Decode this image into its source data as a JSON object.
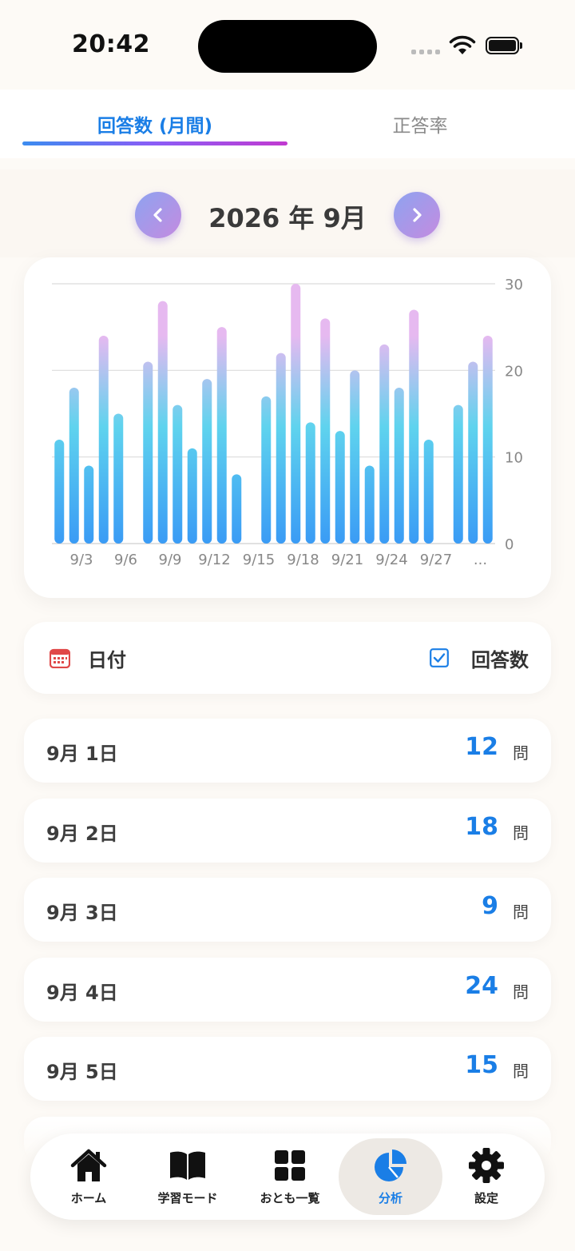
{
  "status_bar": {
    "time": "20:42"
  },
  "tabs": [
    {
      "label": "回答数 (月間)",
      "active": true
    },
    {
      "label": "正答率",
      "active": false
    }
  ],
  "month_nav": {
    "title": "2026 年 9月",
    "prev_icon": "chevron-left-icon",
    "next_icon": "chevron-right-icon"
  },
  "chart_data": {
    "type": "bar",
    "categories": [
      "9/1",
      "9/2",
      "9/3",
      "9/4",
      "9/5",
      "9/6",
      "9/7",
      "9/8",
      "9/9",
      "9/10",
      "9/11",
      "9/12",
      "9/13",
      "9/14",
      "9/15",
      "9/16",
      "9/17",
      "9/18",
      "9/19",
      "9/20",
      "9/21",
      "9/22",
      "9/23",
      "9/24",
      "9/25",
      "9/26",
      "9/27",
      "9/28",
      "9/29",
      "9/30"
    ],
    "values": [
      12,
      18,
      9,
      24,
      15,
      0,
      21,
      28,
      16,
      11,
      19,
      25,
      8,
      0,
      17,
      22,
      30,
      14,
      26,
      13,
      20,
      9,
      23,
      18,
      27,
      12,
      0,
      16,
      21,
      24
    ],
    "x_tick_labels": [
      "9/3",
      "9/6",
      "9/9",
      "9/12",
      "9/15",
      "9/18",
      "9/21",
      "9/24",
      "9/27",
      "..."
    ],
    "y_ticks": [
      0,
      10,
      20,
      30
    ],
    "ylim": [
      0,
      30
    ],
    "grid": true,
    "colors": {
      "bottom": "#3a9bf5",
      "middle": "#5fd3ee",
      "top": "#e6b9f0"
    }
  },
  "list_header": {
    "date_label": "日付",
    "count_label": "回答数",
    "date_icon": "calendar-icon",
    "count_icon": "checkbox-icon"
  },
  "rows": [
    {
      "date": "9月 1日",
      "value": "12",
      "unit": "問"
    },
    {
      "date": "9月 2日",
      "value": "18",
      "unit": "問"
    },
    {
      "date": "9月 3日",
      "value": "9",
      "unit": "問"
    },
    {
      "date": "9月 4日",
      "value": "24",
      "unit": "問"
    },
    {
      "date": "9月 5日",
      "value": "15",
      "unit": "問"
    }
  ],
  "bottom_nav": [
    {
      "label": "ホーム",
      "icon": "home-icon"
    },
    {
      "label": "学習モード",
      "icon": "book-icon"
    },
    {
      "label": "おとも一覧",
      "icon": "grid-icon"
    },
    {
      "label": "分析",
      "icon": "pie-chart-icon",
      "active": true
    },
    {
      "label": "設定",
      "icon": "gear-icon"
    }
  ],
  "accent_color": "#1a7ee6"
}
